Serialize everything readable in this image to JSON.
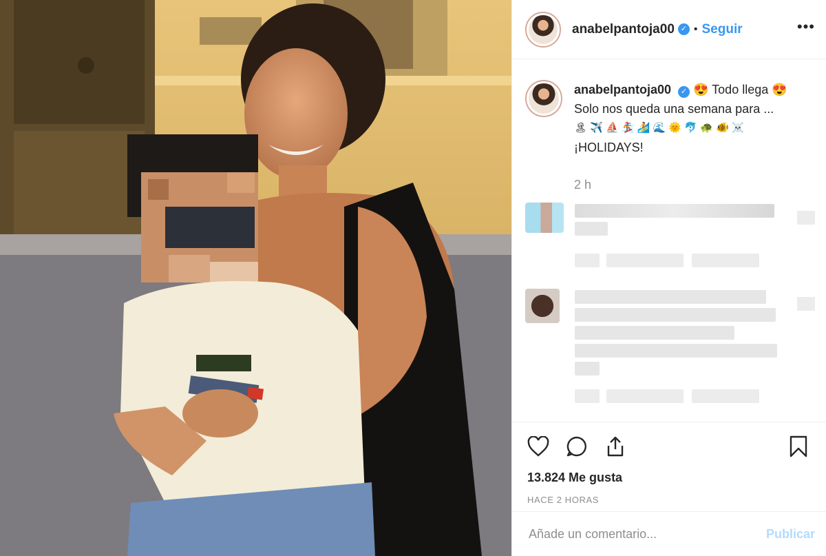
{
  "post": {
    "username": "anabelpantoja00",
    "verified_icon": "verified-badge-icon",
    "separator": "•",
    "follow_label": "Seguir",
    "more_label": "•••"
  },
  "caption": {
    "username": "anabelpantoja00",
    "line1": "😍 Todo llega 😍",
    "line2": "Solo nos queda una semana para ...",
    "line3": "🏝 ✈️ ⛵ 🏂 🏄 🌊 🌞 🐬 🐢 🐠 ☠️",
    "line4": "¡HOLIDAYS!",
    "time": "2 h"
  },
  "actions": {
    "likes": "13.824 Me gusta",
    "ago": "HACE 2 HORAS"
  },
  "comment_box": {
    "placeholder": "Añade un comentario...",
    "publish_label": "Publicar"
  },
  "colors": {
    "accent": "#3897f0",
    "publish_disabled": "#b3dbff",
    "muted": "#8e8e8e"
  }
}
